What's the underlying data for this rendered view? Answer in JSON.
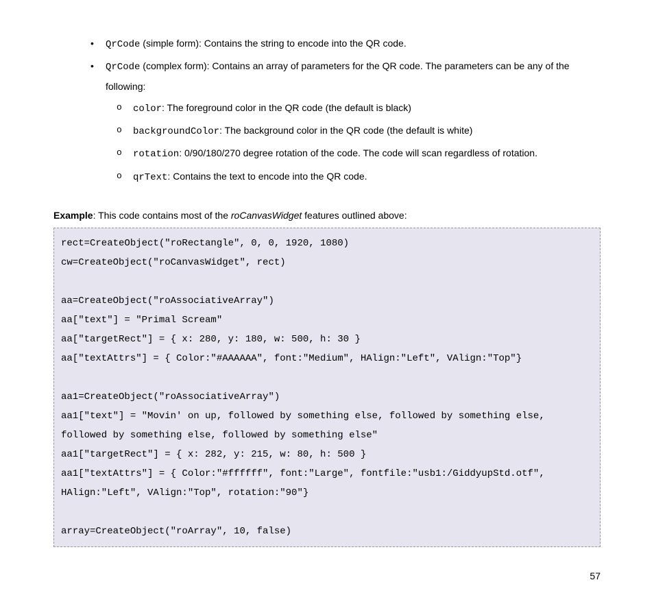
{
  "bullets": [
    {
      "code": "QrCode",
      "rest": " (simple form): Contains the string to encode into the QR code."
    },
    {
      "code": "QrCode",
      "rest": " (complex form): Contains an array of parameters for the QR code. The parameters can be any of the following:"
    }
  ],
  "sublist": [
    {
      "code": "color",
      "rest": ": The foreground color in the QR code (the default is black)"
    },
    {
      "code": "backgroundColor",
      "rest": ": The background color in the QR code (the default is white)"
    },
    {
      "code": "rotation",
      "rest": ": 0/90/180/270 degree rotation of the code. The code will scan regardless of rotation."
    },
    {
      "code": "qrText",
      "rest": ": Contains the text to encode into the QR code."
    }
  ],
  "example": {
    "bold": "Example",
    "middle": ": This code contains most of the ",
    "italic": "roCanvasWidget",
    "tail": " features outlined above:"
  },
  "code": "rect=CreateObject(\"roRectangle\", 0, 0, 1920, 1080)\ncw=CreateObject(\"roCanvasWidget\", rect)\n\naa=CreateObject(\"roAssociativeArray\")\naa[\"text\"] = \"Primal Scream\"\naa[\"targetRect\"] = { x: 280, y: 180, w: 500, h: 30 }\naa[\"textAttrs\"] = { Color:\"#AAAAAA\", font:\"Medium\", HAlign:\"Left\", VAlign:\"Top\"}\n\naa1=CreateObject(\"roAssociativeArray\")\naa1[\"text\"] = \"Movin' on up, followed by something else, followed by something else, followed by something else, followed by something else\"\naa1[\"targetRect\"] = { x: 282, y: 215, w: 80, h: 500 }\naa1[\"textAttrs\"] = { Color:\"#ffffff\", font:\"Large\", fontfile:\"usb1:/GiddyupStd.otf\", HAlign:\"Left\", VAlign:\"Top\", rotation:\"90\"}\n\narray=CreateObject(\"roArray\", 10, false)",
  "pageNumber": "57"
}
